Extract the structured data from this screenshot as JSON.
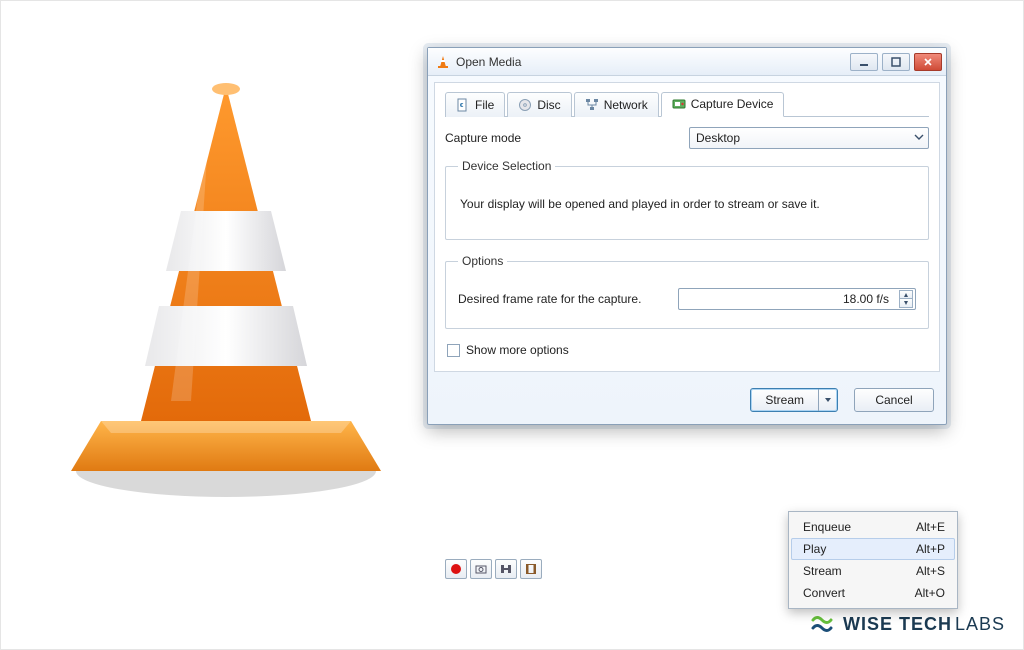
{
  "window": {
    "title": "Open Media"
  },
  "tabs": {
    "file": "File",
    "disc": "Disc",
    "network": "Network",
    "capture": "Capture Device"
  },
  "capture": {
    "mode_label": "Capture mode",
    "mode_value": "Desktop",
    "device_selection": {
      "legend": "Device Selection",
      "description": "Your display will be opened and played in order to stream or save it."
    },
    "options": {
      "legend": "Options",
      "fps_label": "Desired frame rate for the capture.",
      "fps_value": "18.00 f/s"
    }
  },
  "show_more": "Show more options",
  "footer": {
    "primary": "Stream",
    "cancel": "Cancel"
  },
  "menu": [
    {
      "label": "Enqueue",
      "shortcut": "Alt+E"
    },
    {
      "label": "Play",
      "shortcut": "Alt+P"
    },
    {
      "label": "Stream",
      "shortcut": "Alt+S"
    },
    {
      "label": "Convert",
      "shortcut": "Alt+O"
    }
  ],
  "toolbar_icons": [
    "record-icon",
    "snapshot-icon",
    "camera-icon",
    "frame-icon"
  ],
  "brand": {
    "strong": "WISE TECH",
    "light": "LABS"
  }
}
